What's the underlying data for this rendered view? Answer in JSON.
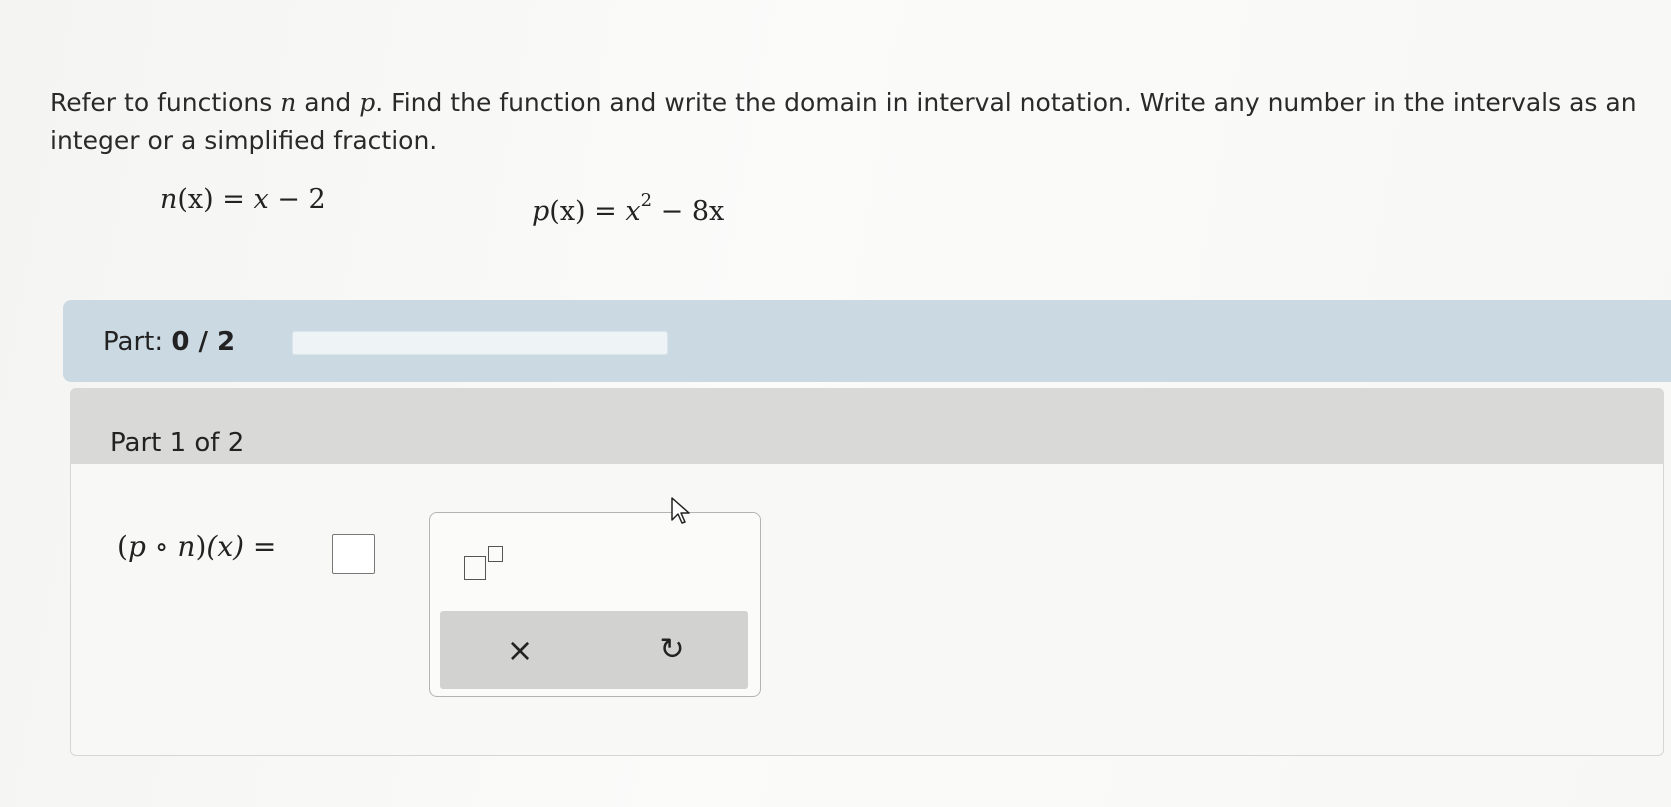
{
  "prompt": {
    "part1": "Refer to functions ",
    "var_n": "n",
    "and": " and ",
    "var_p": "p",
    "part2": ". Find the function and write the domain in interval notation. Write any number in the intervals as an integer or a simplified fraction."
  },
  "functions": {
    "n_name": "n",
    "n_arg": "(x)",
    "n_eq": " = ",
    "n_rhs_var": "x",
    "n_rhs_rest": " − 2",
    "p_name": "p",
    "p_arg": "(x)",
    "p_eq": " = ",
    "p_rhs_var": "x",
    "p_rhs_exp": "2",
    "p_rhs_rest": " − 8x"
  },
  "progress": {
    "label": "Part: ",
    "value": "0 / 2",
    "completed": 0,
    "total": 2
  },
  "part": {
    "title": "Part 1 of 2",
    "expr_open": "(",
    "expr_p": "p",
    "expr_circ": " ∘ ",
    "expr_n": "n",
    "expr_close": ")",
    "expr_x": "(x)",
    "expr_eq": " = "
  },
  "palette": {
    "clear_label": "×",
    "undo_label": "↻"
  }
}
